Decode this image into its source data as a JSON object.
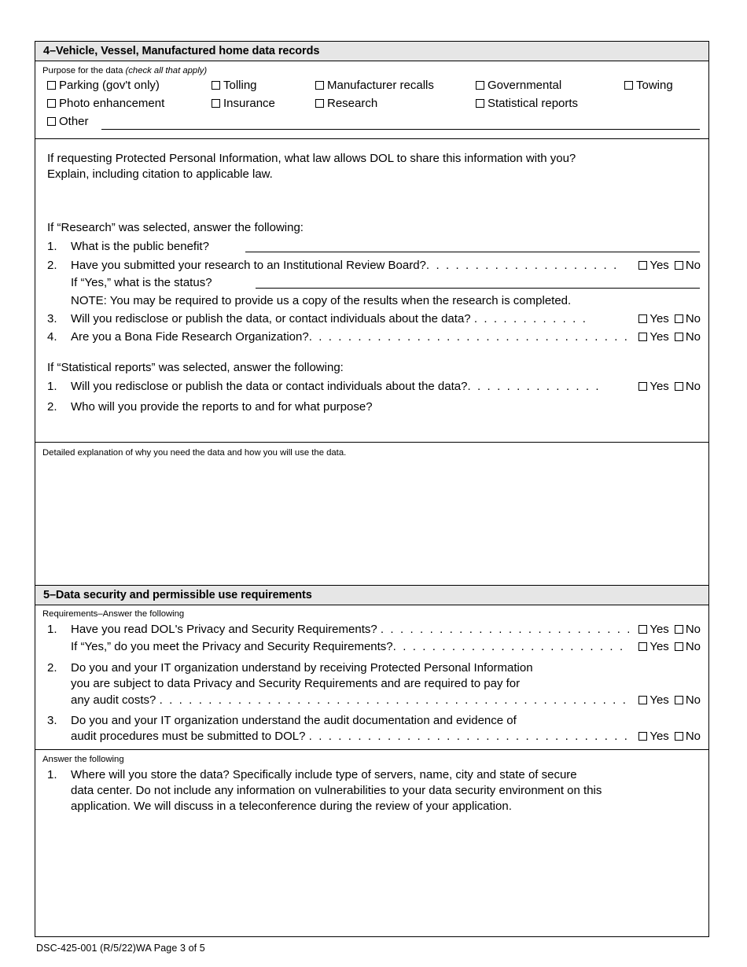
{
  "section4": {
    "header": "4–Vehicle, Vessel, Manufactured home data records",
    "purpose_label_main": "Purpose for the data ",
    "purpose_label_italic": "(check all that apply)",
    "purpose_options": [
      "Parking (gov't only)",
      "Tolling",
      "Manufacturer recalls",
      "Governmental",
      "Towing",
      "Photo enhancement",
      "Insurance",
      "Research",
      "Statistical reports",
      "Other"
    ],
    "ppi_question_line1": "If requesting Protected Personal Information, what law allows DOL to share this information with you?",
    "ppi_question_line2": "Explain, including citation to applicable law.",
    "research_leadin": "If “Research” was selected, answer the following:",
    "research_q1_num": "1.",
    "research_q1": "What is the public benefit?",
    "research_q2_num": "2.",
    "research_q2": "Have you submitted your research to an Institutional Review Board?",
    "research_q2_dots": ". . . . . . . . . . . . . . . . . . . .",
    "research_q2_sub": "If “Yes,” what is the status?",
    "research_note": "NOTE: You may be required to provide us a copy of the results when the research is completed.",
    "research_q3_num": "3.",
    "research_q3": "Will you redisclose or publish the data, or contact individuals about the data?",
    "research_q3_dots": ". . . . . . . . . . . .",
    "research_q4_num": "4.",
    "research_q4": "Are you a Bona Fide Research Organization?",
    "research_q4_dots": ". . . . . . . . . . . . . . . . . . . . . . . . . . . . . . . . . . .",
    "stats_leadin": "If “Statistical reports” was selected, answer the following:",
    "stats_q1_num": "1.",
    "stats_q1": "Will you redisclose or publish the data or contact individuals about the data?",
    "stats_q1_dots": ". . . . . . . . . . . . . .",
    "stats_q2_num": "2.",
    "stats_q2": "Who will you provide the reports to and for what purpose?",
    "detailed_explanation_label": "Detailed explanation of why you need the data and how you will use the data."
  },
  "section5": {
    "header": "5–Data security and permissible use requirements",
    "requirements_label": "Requirements–Answer the following",
    "q1_num": "1.",
    "q1": "Have you read DOL's Privacy and Security Requirements?",
    "q1_dots": ". . . . . . . . . . . . . . . . . . . . . . . . . .",
    "q1_sub": "If “Yes,” do you meet the Privacy and Security Requirements?",
    "q1_sub_dots": ". . . . . . . . . . . . . . . . . . . . . . . .",
    "q2_num": "2.",
    "q2_line1": "Do you and your IT organization understand by receiving Protected Personal Information",
    "q2_line2": "you are subject to data Privacy and Security Requirements and are required to pay for",
    "q2_line3": "any audit costs?",
    "q2_dots": ". . . . . . . . . . . . . . . . . . . . . . . . . . . . . . . . . . . . . . . . . . . . . . . . . . . . . . . . . .",
    "q3_num": "3.",
    "q3_line1": "Do you and your IT organization understand the audit documentation and evidence of",
    "q3_line2": "audit procedures must be submitted to DOL?",
    "q3_dots": ". . . . . . . . . . . . . . . . . . . . . . . . . . . . . . . . . . . .",
    "answer_label": "Answer the following",
    "answer_q1_num": "1.",
    "answer_q1_line1": "Where will you store the data? Specifically include type of servers, name, city and state of secure",
    "answer_q1_line2": "data center. Do not include any information on vulnerabilities to your data security environment on this",
    "answer_q1_line3": "application. We will discuss in a teleconference during the review of your application."
  },
  "common": {
    "yes_label": "Yes",
    "no_label": "No"
  },
  "footer": {
    "text": "DSC-425-001 (R/5/22)WA Page 3 of 5"
  }
}
